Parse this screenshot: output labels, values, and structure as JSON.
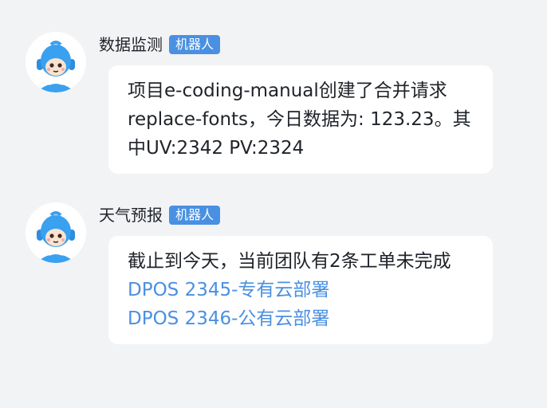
{
  "messages": [
    {
      "sender": "数据监测",
      "badge": "机器人",
      "text": "项目e-coding-manual创建了合并请求replace-fonts，今日数据为: 123.23。其中UV:2342  PV:2324"
    },
    {
      "sender": "天气预报",
      "badge": "机器人",
      "text": "截止到今天，当前团队有2条工单未完成",
      "links": [
        "DPOS 2345-专有云部署",
        "DPOS 2346-公有云部署"
      ]
    }
  ],
  "colors": {
    "background": "#f2f3f5",
    "bubble": "#ffffff",
    "accent": "#4a90e2",
    "text": "#1f2329"
  },
  "icons": {
    "avatar": "robot-mascot-icon"
  }
}
